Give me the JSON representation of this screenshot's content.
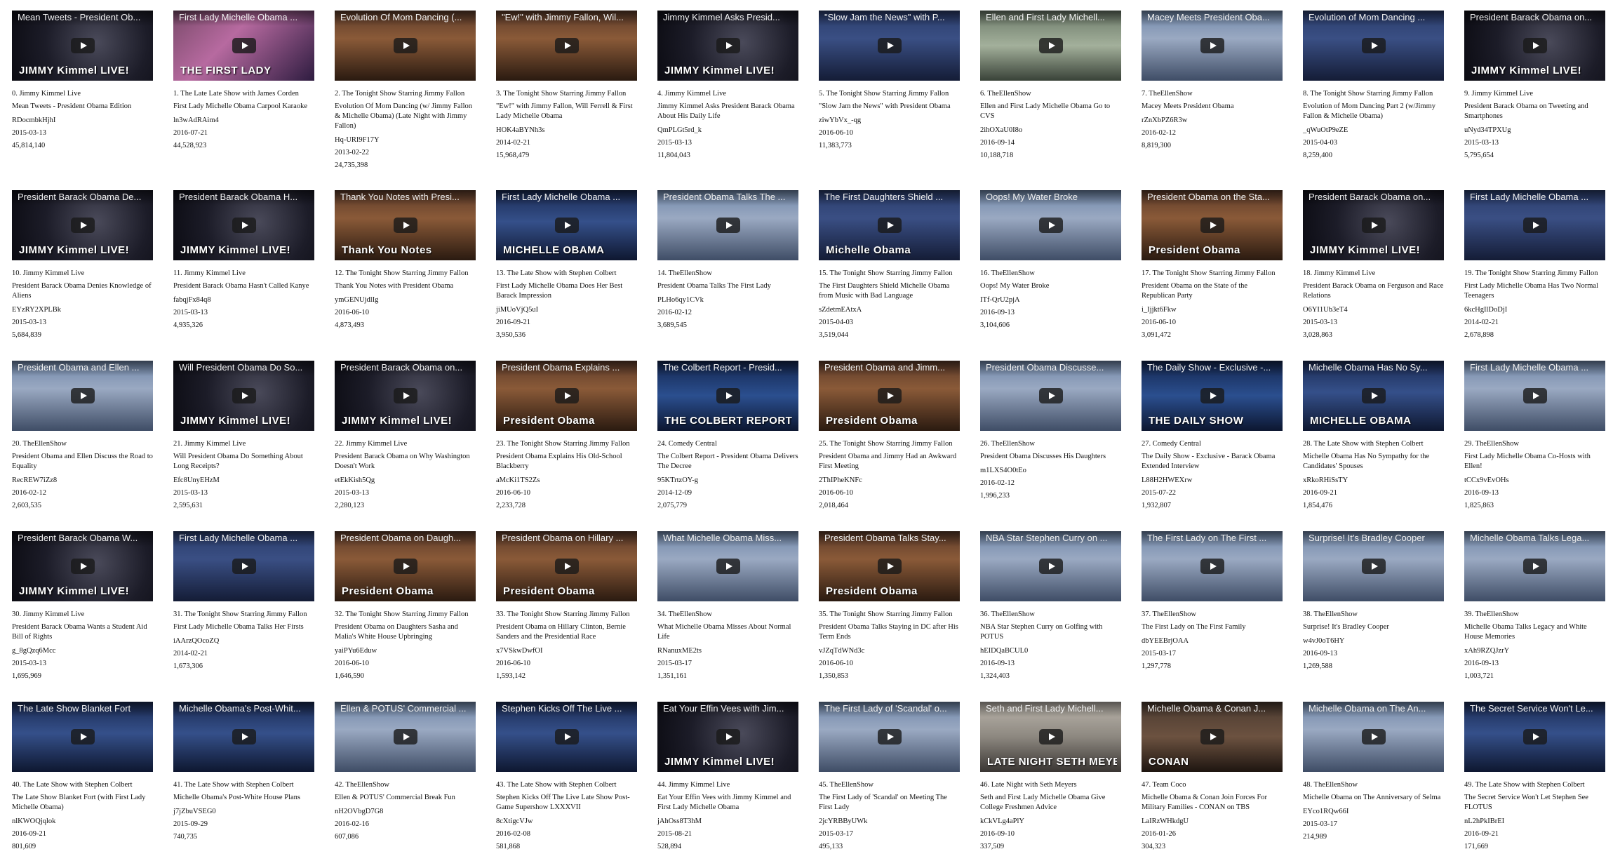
{
  "videos": [
    {
      "thumb_title": "Mean Tweets - President Ob...",
      "channel_line": "0. Jimmy Kimmel Live",
      "title": "Mean Tweets - President Obama Edition",
      "video_id": "RDocmbkHjhI",
      "date": "2015-03-13",
      "views": "45,814,140",
      "style": "kimmel",
      "logo": "JIMMY Kimmel LIVE!"
    },
    {
      "thumb_title": "First Lady Michelle Obama ...",
      "channel_line": "1. The Late Late Show with James Corden",
      "title": "First Lady Michelle Obama Carpool Karaoke",
      "video_id": "ln3wAdRAim4",
      "date": "2016-07-21",
      "views": "44,528,923",
      "style": "corden",
      "logo": "THE FIRST LADY"
    },
    {
      "thumb_title": "Evolution Of Mom Dancing (...",
      "channel_line": "2. The Tonight Show Starring Jimmy Fallon",
      "title": "Evolution Of Mom Dancing (w/ Jimmy Fallon & Michelle Obama) (Late Night with Jimmy Fallon)",
      "video_id": "Hq-URI9F17Y",
      "date": "2013-02-22",
      "views": "24,735,398",
      "style": "fallon",
      "logo": ""
    },
    {
      "thumb_title": "\"Ew!\" with Jimmy Fallon, Wil...",
      "channel_line": "3. The Tonight Show Starring Jimmy Fallon",
      "title": "\"Ew!\" with Jimmy Fallon, Will Ferrell & First Lady Michelle Obama",
      "video_id": "HOK4aBYNh3s",
      "date": "2014-02-21",
      "views": "15,968,479",
      "style": "fallon",
      "logo": ""
    },
    {
      "thumb_title": "Jimmy Kimmel Asks Presid...",
      "channel_line": "4. Jimmy Kimmel Live",
      "title": "Jimmy Kimmel Asks President Barack Obama About His Daily Life",
      "video_id": "QmPLGt5rd_k",
      "date": "2015-03-13",
      "views": "11,804,043",
      "style": "kimmel",
      "logo": "JIMMY Kimmel LIVE!"
    },
    {
      "thumb_title": "\"Slow Jam the News\" with P...",
      "channel_line": "5. The Tonight Show Starring Jimmy Fallon",
      "title": "\"Slow Jam the News\" with President Obama",
      "video_id": "ziwYbVx_-qg",
      "date": "2016-06-10",
      "views": "11,383,773",
      "style": "fallonblue",
      "logo": ""
    },
    {
      "thumb_title": "Ellen and First Lady Michell...",
      "channel_line": "6. TheEllenShow",
      "title": "Ellen and First Lady Michelle Obama Go to CVS",
      "video_id": "2ihOXaU0I8o",
      "date": "2016-09-14",
      "views": "10,188,718",
      "style": "cvs",
      "logo": ""
    },
    {
      "thumb_title": "Macey Meets President Oba...",
      "channel_line": "7. TheEllenShow",
      "title": "Macey Meets President Obama",
      "video_id": "rZnXbPZ6R3w",
      "date": "2016-02-12",
      "views": "8,819,300",
      "style": "ellen",
      "logo": ""
    },
    {
      "thumb_title": "Evolution of Mom Dancing ...",
      "channel_line": "8. The Tonight Show Starring Jimmy Fallon",
      "title": "Evolution of Mom Dancing Part 2 (w/Jimmy Fallon & Michelle Obama)",
      "video_id": "_qWuOtP9eZE",
      "date": "2015-04-03",
      "views": "8,259,400",
      "style": "fallonblue",
      "logo": ""
    },
    {
      "thumb_title": "President Barack Obama on...",
      "channel_line": "9. Jimmy Kimmel Live",
      "title": "President Barack Obama on Tweeting and Smartphones",
      "video_id": "uNyd34TPXUg",
      "date": "2015-03-13",
      "views": "5,795,654",
      "style": "kimmel",
      "logo": "JIMMY Kimmel LIVE!"
    },
    {
      "thumb_title": "President Barack Obama De...",
      "channel_line": "10. Jimmy Kimmel Live",
      "title": "President Barack Obama Denies Knowledge of Aliens",
      "video_id": "EYzRY2XPLBk",
      "date": "2015-03-13",
      "views": "5,684,839",
      "style": "kimmel",
      "logo": "JIMMY Kimmel LIVE!"
    },
    {
      "thumb_title": "President Barack Obama H...",
      "channel_line": "11. Jimmy Kimmel Live",
      "title": "President Barack Obama Hasn't Called Kanye",
      "video_id": "fabqjFx84q8",
      "date": "2015-03-13",
      "views": "4,935,326",
      "style": "kimmel",
      "logo": "JIMMY Kimmel LIVE!"
    },
    {
      "thumb_title": "Thank You Notes with Presi...",
      "channel_line": "12. The Tonight Show Starring Jimmy Fallon",
      "title": "Thank You Notes with President Obama",
      "video_id": "ymGENUjdlIg",
      "date": "2016-06-10",
      "views": "4,873,493",
      "style": "fallon",
      "logo": "Thank You Notes"
    },
    {
      "thumb_title": "First Lady Michelle Obama ...",
      "channel_line": "13. The Late Show with Stephen Colbert",
      "title": "First Lady Michelle Obama Does Her Best Barack Impression",
      "video_id": "jiMUoVjQ5uI",
      "date": "2016-09-21",
      "views": "3,950,536",
      "style": "colbert",
      "logo": "MICHELLE OBAMA"
    },
    {
      "thumb_title": "President Obama Talks The ...",
      "channel_line": "14. TheEllenShow",
      "title": "President Obama Talks The First Lady",
      "video_id": "PLHo6qy1CVk",
      "date": "2016-02-12",
      "views": "3,689,545",
      "style": "ellen",
      "logo": ""
    },
    {
      "thumb_title": "The First Daughters Shield ...",
      "channel_line": "15. The Tonight Show Starring Jimmy Fallon",
      "title": "The First Daughters Shield Michelle Obama from Music with Bad Language",
      "video_id": "sZdetmEAtxA",
      "date": "2015-04-03",
      "views": "3,519,044",
      "style": "fallonblue",
      "logo": "Michelle Obama"
    },
    {
      "thumb_title": "Oops! My Water Broke",
      "channel_line": "16. TheEllenShow",
      "title": "Oops! My Water Broke",
      "video_id": "ITf-QrU2pjA",
      "date": "2016-09-13",
      "views": "3,104,606",
      "style": "ellen",
      "logo": ""
    },
    {
      "thumb_title": "President Obama on the Sta...",
      "channel_line": "17. The Tonight Show Starring Jimmy Fallon",
      "title": "President Obama on the State of the Republican Party",
      "video_id": "i_Ijjkt6Fkw",
      "date": "2016-06-10",
      "views": "3,091,472",
      "style": "fallon",
      "logo": "President Obama"
    },
    {
      "thumb_title": "President Barack Obama on...",
      "channel_line": "18. Jimmy Kimmel Live",
      "title": "President Barack Obama on Ferguson and Race Relations",
      "video_id": "O6YI1Ub3eT4",
      "date": "2015-03-13",
      "views": "3,028,863",
      "style": "kimmel",
      "logo": "JIMMY Kimmel LIVE!"
    },
    {
      "thumb_title": "First Lady Michelle Obama ...",
      "channel_line": "19. The Tonight Show Starring Jimmy Fallon",
      "title": "First Lady Michelle Obama Has Two Normal Teenagers",
      "video_id": "6kcHgIlDoDjI",
      "date": "2014-02-21",
      "views": "2,678,898",
      "style": "fallonblue",
      "logo": ""
    },
    {
      "thumb_title": "President Obama and Ellen ...",
      "channel_line": "20. TheEllenShow",
      "title": "President Obama and Ellen Discuss the Road to Equality",
      "video_id": "RecREW7iZz8",
      "date": "2016-02-12",
      "views": "2,603,535",
      "style": "ellen",
      "logo": ""
    },
    {
      "thumb_title": "Will President Obama Do So...",
      "channel_line": "21. Jimmy Kimmel Live",
      "title": "Will President Obama Do Something About Long Receipts?",
      "video_id": "Efc8UnyEHzM",
      "date": "2015-03-13",
      "views": "2,595,631",
      "style": "kimmel",
      "logo": "JIMMY Kimmel LIVE!"
    },
    {
      "thumb_title": "President Barack Obama on...",
      "channel_line": "22. Jimmy Kimmel Live",
      "title": "President Barack Obama on Why Washington Doesn't Work",
      "video_id": "etEkKish5Qg",
      "date": "2015-03-13",
      "views": "2,280,123",
      "style": "kimmel",
      "logo": "JIMMY Kimmel LIVE!"
    },
    {
      "thumb_title": "President Obama Explains ...",
      "channel_line": "23. The Tonight Show Starring Jimmy Fallon",
      "title": "President Obama Explains His Old-School Blackberry",
      "video_id": "aMcKi1TS2Zs",
      "date": "2016-06-10",
      "views": "2,233,728",
      "style": "fallon",
      "logo": "President Obama"
    },
    {
      "thumb_title": "The Colbert Report - Presid...",
      "channel_line": "24. Comedy Central",
      "title": "The Colbert Report - President Obama Delivers The Decree",
      "video_id": "95KTrtzOY-g",
      "date": "2014-12-09",
      "views": "2,075,779",
      "style": "comedy",
      "logo": "THE COLBERT REPORT"
    },
    {
      "thumb_title": "President Obama and Jimm...",
      "channel_line": "25. The Tonight Show Starring Jimmy Fallon",
      "title": "President Obama and Jimmy Had an Awkward First Meeting",
      "video_id": "2ThIPheKNFc",
      "date": "2016-06-10",
      "views": "2,018,464",
      "style": "fallon",
      "logo": "President Obama"
    },
    {
      "thumb_title": "President Obama Discusse...",
      "channel_line": "26. TheEllenShow",
      "title": "President Obama Discusses His Daughters",
      "video_id": "m1LXS4O0tEo",
      "date": "2016-02-12",
      "views": "1,996,233",
      "style": "ellen",
      "logo": ""
    },
    {
      "thumb_title": "The Daily Show - Exclusive -...",
      "channel_line": "27. Comedy Central",
      "title": "The Daily Show - Exclusive - Barack Obama Extended Interview",
      "video_id": "L88H2HWEXrw",
      "date": "2015-07-22",
      "views": "1,932,807",
      "style": "comedy",
      "logo": "THE DAILY SHOW"
    },
    {
      "thumb_title": "Michelle Obama Has No Sy...",
      "channel_line": "28. The Late Show with Stephen Colbert",
      "title": "Michelle Obama Has No Sympathy for the Candidates' Spouses",
      "video_id": "xRkoRHiSsTY",
      "date": "2016-09-21",
      "views": "1,854,476",
      "style": "colbert",
      "logo": "MICHELLE OBAMA"
    },
    {
      "thumb_title": "First Lady Michelle Obama ...",
      "channel_line": "29. TheEllenShow",
      "title": "First Lady Michelle Obama Co-Hosts with Ellen!",
      "video_id": "tCCx9vEvOHs",
      "date": "2016-09-13",
      "views": "1,825,863",
      "style": "ellen",
      "logo": ""
    },
    {
      "thumb_title": "President Barack Obama W...",
      "channel_line": "30. Jimmy Kimmel Live",
      "title": "President Barack Obama Wants a Student Aid Bill of Rights",
      "video_id": "g_8gQzq6Mcc",
      "date": "2015-03-13",
      "views": "1,695,969",
      "style": "kimmel",
      "logo": "JIMMY Kimmel LIVE!"
    },
    {
      "thumb_title": "First Lady Michelle Obama ...",
      "channel_line": "31. The Tonight Show Starring Jimmy Fallon",
      "title": "First Lady Michelle Obama Talks Her Firsts",
      "video_id": "iAArzQOcoZQ",
      "date": "2014-02-21",
      "views": "1,673,306",
      "style": "fallonblue",
      "logo": ""
    },
    {
      "thumb_title": "President Obama on Daugh...",
      "channel_line": "32. The Tonight Show Starring Jimmy Fallon",
      "title": "President Obama on Daughters Sasha and Malia's White House Upbringing",
      "video_id": "yaiPYu6Eduw",
      "date": "2016-06-10",
      "views": "1,646,590",
      "style": "fallon",
      "logo": "President Obama"
    },
    {
      "thumb_title": "President Obama on Hillary ...",
      "channel_line": "33. The Tonight Show Starring Jimmy Fallon",
      "title": "President Obama on Hillary Clinton, Bernie Sanders and the Presidential Race",
      "video_id": "x7VSkwDwfOI",
      "date": "2016-06-10",
      "views": "1,593,142",
      "style": "fallon",
      "logo": "President Obama"
    },
    {
      "thumb_title": "What Michelle Obama Miss...",
      "channel_line": "34. TheEllenShow",
      "title": "What Michelle Obama Misses About Normal Life",
      "video_id": "RNanuxME2ts",
      "date": "2015-03-17",
      "views": "1,351,161",
      "style": "ellen",
      "logo": ""
    },
    {
      "thumb_title": "President Obama Talks Stay...",
      "channel_line": "35. The Tonight Show Starring Jimmy Fallon",
      "title": "President Obama Talks Staying in DC after His Term Ends",
      "video_id": "vJZqTdWNd3c",
      "date": "2016-06-10",
      "views": "1,350,853",
      "style": "fallon",
      "logo": "President Obama"
    },
    {
      "thumb_title": "NBA Star Stephen Curry on ...",
      "channel_line": "36. TheEllenShow",
      "title": "NBA Star Stephen Curry on Golfing with POTUS",
      "video_id": "hEIDQaBCUL0",
      "date": "2016-09-13",
      "views": "1,324,403",
      "style": "ellen",
      "logo": ""
    },
    {
      "thumb_title": "The First Lady on The First ...",
      "channel_line": "37. TheEllenShow",
      "title": "The First Lady on The First Family",
      "video_id": "dbYEEBrjOAA",
      "date": "2015-03-17",
      "views": "1,297,778",
      "style": "ellen",
      "logo": ""
    },
    {
      "thumb_title": "Surprise! It's Bradley Cooper",
      "channel_line": "38. TheEllenShow",
      "title": "Surprise! It's Bradley Cooper",
      "video_id": "w4vJ0oT6HY",
      "date": "2016-09-13",
      "views": "1,269,588",
      "style": "ellen",
      "logo": ""
    },
    {
      "thumb_title": "Michelle Obama Talks Lega...",
      "channel_line": "39. TheEllenShow",
      "title": "Michelle Obama Talks Legacy and White House Memories",
      "video_id": "xAh9RZQJzrY",
      "date": "2016-09-13",
      "views": "1,003,721",
      "style": "ellen",
      "logo": ""
    },
    {
      "thumb_title": "The Late Show Blanket Fort",
      "channel_line": "40. The Late Show with Stephen Colbert",
      "title": "The Late Show Blanket Fort (with First Lady Michelle Obama)",
      "video_id": "nlKWOQjqlok",
      "date": "2016-09-21",
      "views": "801,609",
      "style": "colbert",
      "logo": ""
    },
    {
      "thumb_title": "Michelle Obama's Post-Whit...",
      "channel_line": "41. The Late Show with Stephen Colbert",
      "title": "Michelle Obama's Post-White House Plans",
      "video_id": "j7jZbuVSEG0",
      "date": "2015-09-29",
      "views": "740,735",
      "style": "colbert",
      "logo": ""
    },
    {
      "thumb_title": "Ellen & POTUS' Commercial ...",
      "channel_line": "42. TheEllenShow",
      "title": "Ellen & POTUS' Commercial Break Fun",
      "video_id": "nH2OVbgD7G8",
      "date": "2016-02-16",
      "views": "607,086",
      "style": "ellen",
      "logo": ""
    },
    {
      "thumb_title": "Stephen Kicks Off The Live ...",
      "channel_line": "43. The Late Show with Stephen Colbert",
      "title": "Stephen Kicks Off The Live Late Show Post-Game Supershow LXXXVII",
      "video_id": "8cXtigcVJw",
      "date": "2016-02-08",
      "views": "581,868",
      "style": "colbert",
      "logo": ""
    },
    {
      "thumb_title": "Eat Your Effin Vees with Jim...",
      "channel_line": "44. Jimmy Kimmel Live",
      "title": "Eat Your Effin Vees with Jimmy Kimmel and First Lady Michelle Obama",
      "video_id": "jAhOss8T3hM",
      "date": "2015-08-21",
      "views": "528,894",
      "style": "kimmel",
      "logo": "JIMMY Kimmel LIVE!"
    },
    {
      "thumb_title": "The First Lady of 'Scandal' o...",
      "channel_line": "45. TheEllenShow",
      "title": "The First Lady of 'Scandal' on Meeting The First Lady",
      "video_id": "2jcYRBByUWk",
      "date": "2015-03-17",
      "views": "495,133",
      "style": "ellen",
      "logo": ""
    },
    {
      "thumb_title": "Seth and First Lady Michell...",
      "channel_line": "46. Late Night with Seth Meyers",
      "title": "Seth and First Lady Michelle Obama Give College Freshmen Advice",
      "video_id": "kCkVLg4aPlY",
      "date": "2016-09-10",
      "views": "337,509",
      "style": "seth",
      "logo": "LATE NIGHT SETH MEYERS"
    },
    {
      "thumb_title": "Michelle Obama & Conan J...",
      "channel_line": "47. Team Coco",
      "title": "Michelle Obama & Conan Join Forces For Military Families - CONAN on TBS",
      "video_id": "LaIRzWHkdgU",
      "date": "2016-01-26",
      "views": "304,323",
      "style": "conan",
      "logo": "CONAN"
    },
    {
      "thumb_title": "Michelle Obama on The An...",
      "channel_line": "48. TheEllenShow",
      "title": "Michelle Obama on The Anniversary of Selma",
      "video_id": "EYco1RQw66I",
      "date": "2015-03-17",
      "views": "214,989",
      "style": "ellen",
      "logo": ""
    },
    {
      "thumb_title": "The Secret Service Won't Le...",
      "channel_line": "49. The Late Show with Stephen Colbert",
      "title": "The Secret Service Won't Let Stephen See FLOTUS",
      "video_id": "nL2hPkIBrEI",
      "date": "2016-09-21",
      "views": "171,669",
      "style": "colbert",
      "logo": ""
    }
  ]
}
